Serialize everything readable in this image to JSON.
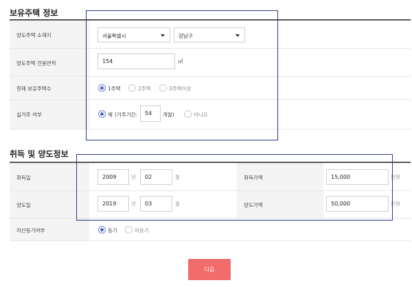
{
  "section1": {
    "title": "보유주택 정보",
    "rows": {
      "location_label": "양도주택 소재지",
      "area_label": "양도주택 전용면적",
      "owned_label": "현재 보유주택수",
      "residence_label": "실거주 여부"
    },
    "city_select": "서울특별시",
    "district_select": "강남구",
    "area_value": "154",
    "area_unit": "㎡",
    "owned_options": [
      "1주택",
      "2주택",
      "3주택이상"
    ],
    "owned_selected": "1주택",
    "residence_yes": "예",
    "residence_period_prefix": "(거주기간:",
    "residence_months": "54",
    "residence_period_suffix": "개월)",
    "residence_no": "아니오",
    "residence_selected": "예"
  },
  "section2": {
    "title": "취득 및 양도정보",
    "acq_label": "취득일",
    "acq_year": "2009",
    "acq_month": "02",
    "acq_price_label": "취득가액",
    "acq_price": "15,000",
    "transfer_label": "양도일",
    "transfer_year": "2019",
    "transfer_month": "03",
    "transfer_price_label": "양도가액",
    "transfer_price": "50,000",
    "year_unit": "년",
    "month_unit": "월",
    "money_unit": "만원",
    "registered_label": "자산등기여부",
    "registered_options": [
      "등기",
      "미등기"
    ],
    "registered_selected": "등기"
  },
  "next_button": "다음",
  "colors": {
    "button": "#f36c6c",
    "radio_selected": "#4a63c9",
    "annotation_box": "#2a3585"
  }
}
